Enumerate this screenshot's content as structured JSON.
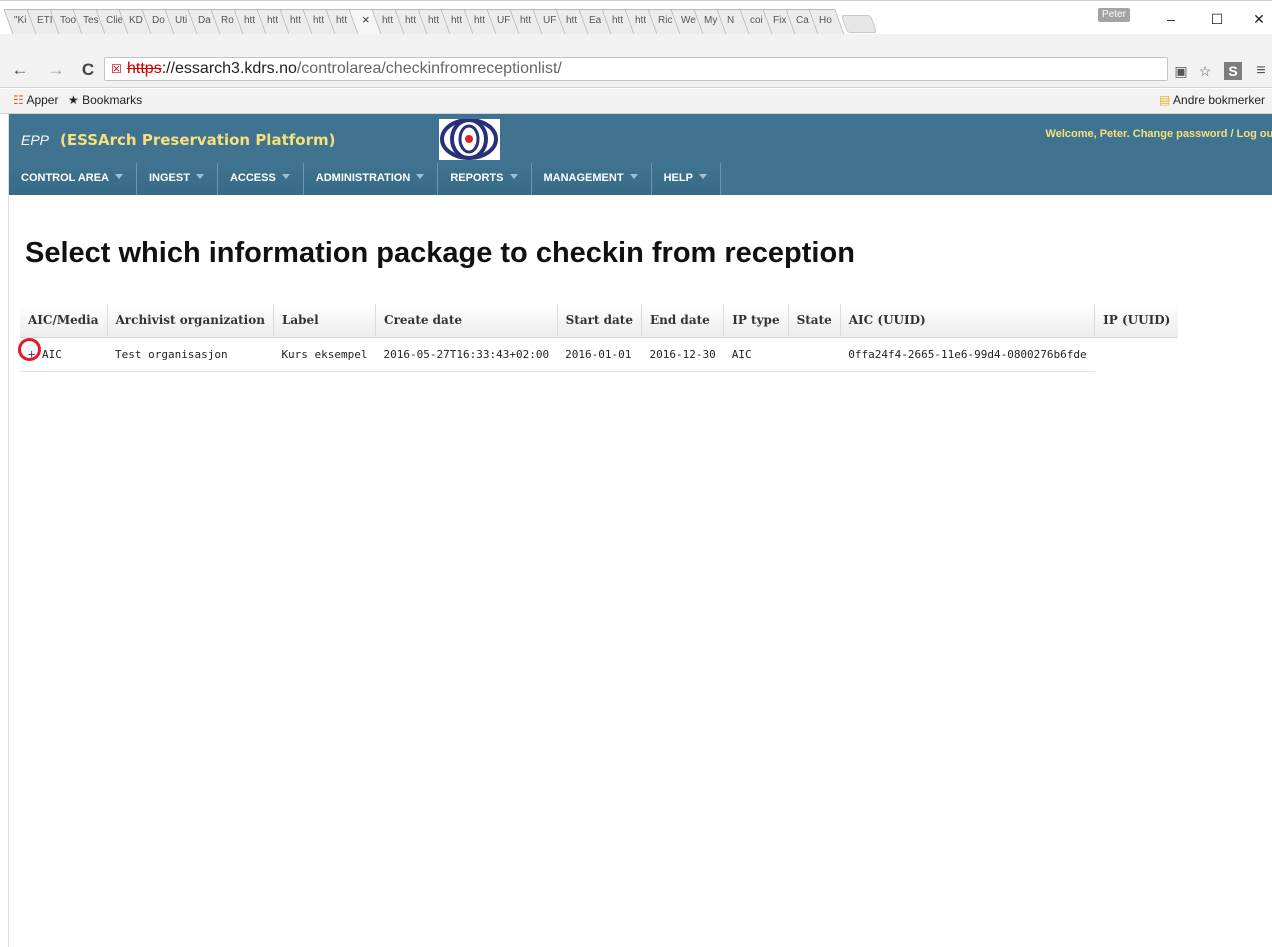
{
  "browser": {
    "tabs": [
      {
        "label": "\"Ki"
      },
      {
        "label": "ETI"
      },
      {
        "label": "Too"
      },
      {
        "label": "Tes"
      },
      {
        "label": "Clie"
      },
      {
        "label": "KD"
      },
      {
        "label": "Do"
      },
      {
        "label": "Uti"
      },
      {
        "label": "Da"
      },
      {
        "label": "Ro"
      },
      {
        "label": "htt"
      },
      {
        "label": "htt"
      },
      {
        "label": "htt"
      },
      {
        "label": "htt"
      },
      {
        "label": "htt"
      },
      {
        "label": "×",
        "active": true
      },
      {
        "label": "htt"
      },
      {
        "label": "htt"
      },
      {
        "label": "htt"
      },
      {
        "label": "htt"
      },
      {
        "label": "htt"
      },
      {
        "label": "UF"
      },
      {
        "label": "htt"
      },
      {
        "label": "UF"
      },
      {
        "label": "htt"
      },
      {
        "label": "Ea"
      },
      {
        "label": "htt"
      },
      {
        "label": "htt"
      },
      {
        "label": "Ric"
      },
      {
        "label": "We"
      },
      {
        "label": "My"
      },
      {
        "label": "N"
      },
      {
        "label": "coi"
      },
      {
        "label": "Fix"
      },
      {
        "label": "Ca"
      },
      {
        "label": "Ho"
      }
    ],
    "profile_name": "Peter",
    "window_controls": {
      "minimize": "–",
      "maximize": "☐",
      "close": "✕"
    },
    "nav": {
      "back": "←",
      "forward": "→",
      "reload": "C"
    },
    "url": {
      "scheme": "https",
      "host": "://essarch3.kdrs.no",
      "path": "/controlarea/checkinfromreceptionlist/"
    },
    "bookmarks_bar": {
      "apps": "Apper",
      "bookmarks": "Bookmarks",
      "other": "Andre bokmerker"
    }
  },
  "app": {
    "abbr": "EPP",
    "name": "(ESSArch Preservation Platform)",
    "welcome": "Welcome, Peter.",
    "change_password": "Change password",
    "separator": " / ",
    "logout": "Log out",
    "menu": [
      {
        "label": "CONTROL AREA"
      },
      {
        "label": "INGEST"
      },
      {
        "label": "ACCESS"
      },
      {
        "label": "ADMINISTRATION"
      },
      {
        "label": "REPORTS"
      },
      {
        "label": "MANAGEMENT"
      },
      {
        "label": "HELP"
      }
    ],
    "accent_color": "#3f7390",
    "header_text_color": "#f6e07c"
  },
  "main": {
    "title": "Select which information package to checkin from reception",
    "table": {
      "columns": [
        "AIC/Media",
        "Archivist organization",
        "Label",
        "Create date",
        "Start date",
        "End date",
        "IP type",
        "State",
        "AIC (UUID)",
        "IP (UUID)"
      ],
      "rows": [
        {
          "expander": "+",
          "aic_media": "AIC",
          "archivist_org": "Test organisasjon",
          "label": "Kurs eksempel",
          "create_date": "2016-05-27T16:33:43+02:00",
          "start_date": "2016-01-01",
          "end_date": "2016-12-30",
          "ip_type": "AIC",
          "state": "",
          "aic_uuid": "0ffa24f4-2665-11e6-99d4-0800276b6fde",
          "ip_uuid": ""
        }
      ]
    }
  }
}
